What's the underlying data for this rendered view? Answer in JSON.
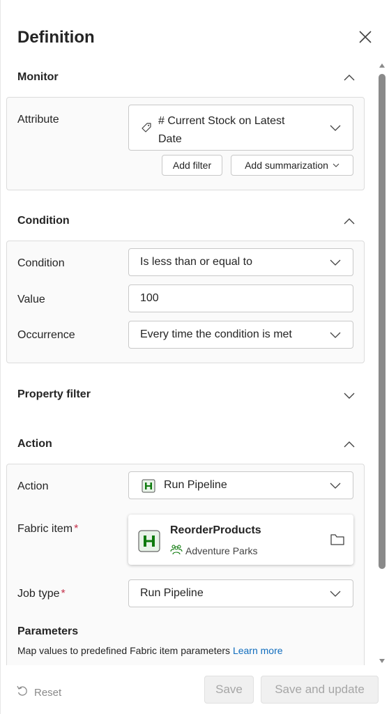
{
  "panel": {
    "title": "Definition"
  },
  "monitor": {
    "title": "Monitor",
    "attribute_label": "Attribute",
    "attribute_line1": "# Current Stock on Latest",
    "attribute_line2": "Date",
    "add_filter": "Add filter",
    "add_summarization": "Add summarization"
  },
  "condition": {
    "title": "Condition",
    "condition_label": "Condition",
    "condition_value": "Is less than or equal to",
    "value_label": "Value",
    "value_value": "100",
    "occurrence_label": "Occurrence",
    "occurrence_value": "Every time the condition is met"
  },
  "property_filter": {
    "title": "Property filter"
  },
  "action": {
    "title": "Action",
    "action_label": "Action",
    "action_value": "Run Pipeline",
    "fabric_label": "Fabric item",
    "required_mark": "*",
    "fabric_item_name": "ReorderProducts",
    "fabric_item_workspace": "Adventure Parks",
    "job_type_label": "Job type",
    "job_type_value": "Run Pipeline",
    "parameters_title": "Parameters",
    "parameters_desc": "Map values to predefined Fabric item parameters",
    "learn_more": "Learn more"
  },
  "footer": {
    "reset": "Reset",
    "save": "Save",
    "save_update": "Save and update"
  },
  "colors": {
    "accent_link": "#0f6cbd",
    "pipeline_green": "#0e7a0d",
    "required_red": "#c4314b"
  }
}
